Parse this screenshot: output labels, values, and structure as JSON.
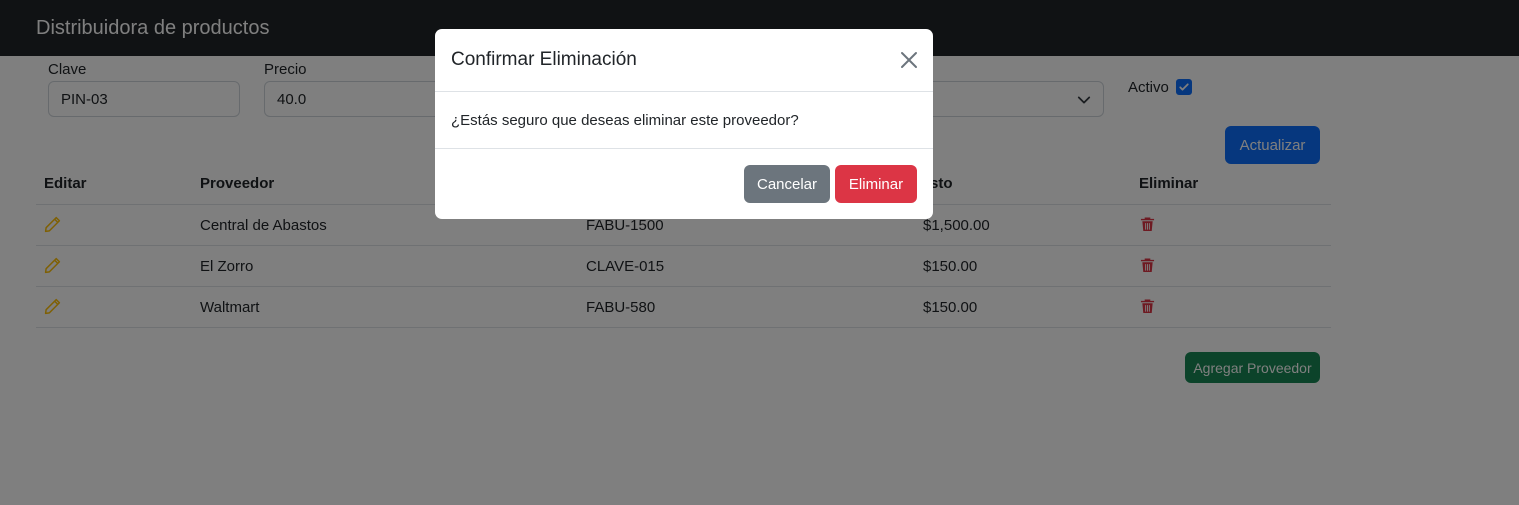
{
  "navbar": {
    "brand": "Distribuidora de productos"
  },
  "form": {
    "clave_label": "Clave",
    "clave_value": "PIN-03",
    "precio_label": "Precio",
    "precio_value": "40.0",
    "activo_label": "Activo",
    "activo_checked": true,
    "update_button": "Actualizar"
  },
  "table": {
    "headers": {
      "editar": "Editar",
      "proveedor": "Proveedor",
      "costo": "Costo",
      "eliminar": "Eliminar"
    },
    "rows": [
      {
        "proveedor": "Central de Abastos",
        "clave": "FABU-1500",
        "costo": "$1,500.00"
      },
      {
        "proveedor": "El Zorro",
        "clave": "CLAVE-015",
        "costo": "$150.00"
      },
      {
        "proveedor": "Waltmart",
        "clave": "FABU-580",
        "costo": "$150.00"
      }
    ],
    "add_button": "Agregar Proveedor"
  },
  "modal": {
    "title": "Confirmar Eliminación",
    "message": "¿Estás seguro que deseas eliminar este proveedor?",
    "cancel_button": "Cancelar",
    "delete_button": "Eliminar"
  },
  "icons": {
    "edit": "pencil-icon",
    "delete": "trash-icon",
    "close": "close-icon",
    "select": "chevron-down-icon",
    "check": "check-icon"
  },
  "colors": {
    "navbar": "#212529",
    "primary": "#0d6efd",
    "success": "#198754",
    "danger": "#dc3545",
    "secondary": "#6c757d",
    "edit_icon": "#ffc107"
  }
}
